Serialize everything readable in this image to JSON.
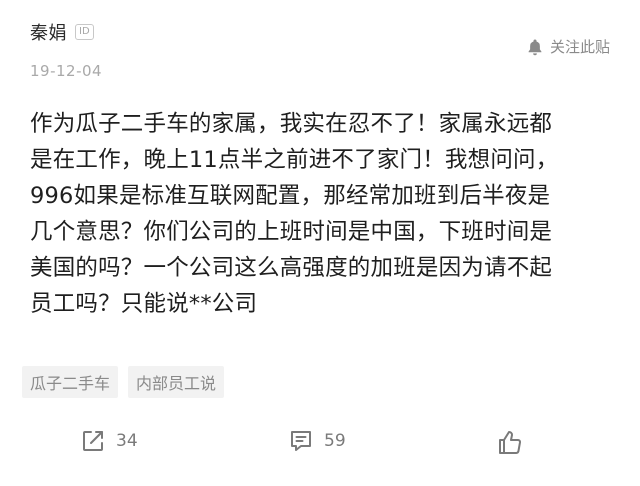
{
  "author": {
    "name": "秦娟",
    "id_badge": "ID",
    "date": "19-12-04"
  },
  "follow": {
    "label": "关注此贴",
    "icon": "bell-icon"
  },
  "post": {
    "lines": [
      "作为瓜子二手车的家属，我实在忍不了！家属永远都",
      "是在工作，晚上11点半之前进不了家门！我想问问，",
      "996如果是标准互联网配置，那经常加班到后半夜是",
      "几个意思？你们公司的上班时间是中国，下班时间是",
      "美国的吗？一个公司这么高强度的加班是因为请不起",
      "员工吗？只能说**公司"
    ]
  },
  "tags": [
    "瓜子二手车",
    "内部员工说"
  ],
  "actions": {
    "share": {
      "icon": "share-icon",
      "count": "34"
    },
    "comment": {
      "icon": "comment-icon",
      "count": "59"
    },
    "like": {
      "icon": "thumbs-up-icon"
    }
  },
  "colors": {
    "text": "#1f1f1f",
    "muted": "#a9a9a9",
    "icon": "#7a7a7a",
    "tag_bg": "#f2f2f2"
  }
}
